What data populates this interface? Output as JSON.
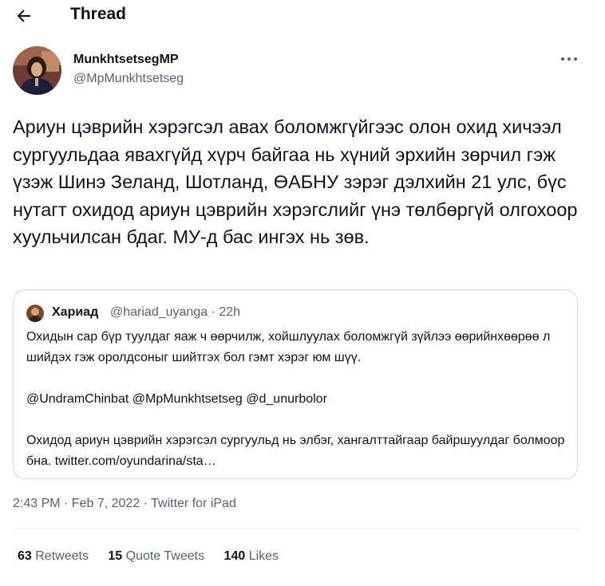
{
  "header": {
    "title": "Thread",
    "back_icon": "arrow-left-icon"
  },
  "tweet": {
    "display_name": "MunkhtsetsegMP",
    "handle": "@MpMunkhtsetseg",
    "text": "Ариун цэврийн хэрэгсэл авах боломжгүйгээс олон охид хичээл сургуульдаа явахгүйд хүрч байгаа нь хүний эрхийн зөрчил гэж үзэж Шинэ Зеланд, Шотланд, ӨАБНУ зэрэг дэлхийн 21 улс, бүс нутагт охидод ариун цэврийн хэрэгслийг үнэ төлбөргүй олгохоор хуульчилсан бдаг. МУ-д бас ингэх нь зөв.",
    "timestamp": "2:43 PM · Feb 7, 2022 · Twitter for iPad"
  },
  "quote": {
    "display_name": "Хариад",
    "handle_time": "@hariad_uyanga · 22h",
    "paragraph1": "Охидын сар бүр туулдаг яаж ч өөрчилж, хойшлуулах боломжгүй зүйлээ өөрийнхөөрөө л шийдэх гэж оролдсоныг шийтгэх бол гэмт хэрэг юм шүү.",
    "paragraph2": "@UndramChinbat @MpMunkhtsetseg @d_unurbolor",
    "paragraph3": "Охидод ариун цэврийн хэрэгсэл сургуульд нь элбэг, хангалттайгаар байршуулдаг болмоор бна. twitter.com/oyundarina/sta…"
  },
  "stats": {
    "retweets_count": "63",
    "retweets_label": "Retweets",
    "quotes_count": "15",
    "quotes_label": "Quote Tweets",
    "likes_count": "140",
    "likes_label": "Likes"
  },
  "colors": {
    "text": "#0f1419",
    "secondary": "#536471",
    "border": "#cfd9de",
    "divider": "#eff3f4"
  }
}
